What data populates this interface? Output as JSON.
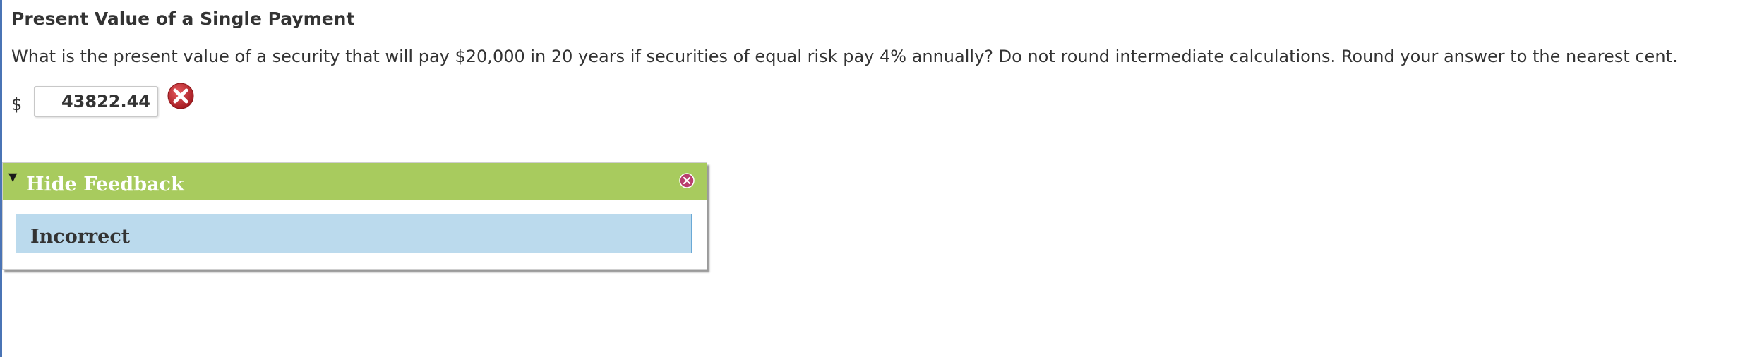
{
  "question": {
    "title": "Present Value of a Single Payment",
    "prompt": "What is the present value of a security that will pay $20,000 in 20 years if securities of equal risk pay 4% annually? Do not round intermediate calculations. Round your answer to the nearest cent.",
    "currency_symbol": "$",
    "answer_value": "43822.44",
    "answer_status_icon": "incorrect-x-icon"
  },
  "feedback": {
    "toggle_label": "Hide Feedback",
    "toggle_arrow": "▼",
    "close_icon": "close-icon",
    "result": "Incorrect",
    "colors": {
      "header": "#a8cb5e",
      "result_box": "#bbdaed",
      "incorrect_mark": "#c0282d"
    }
  }
}
